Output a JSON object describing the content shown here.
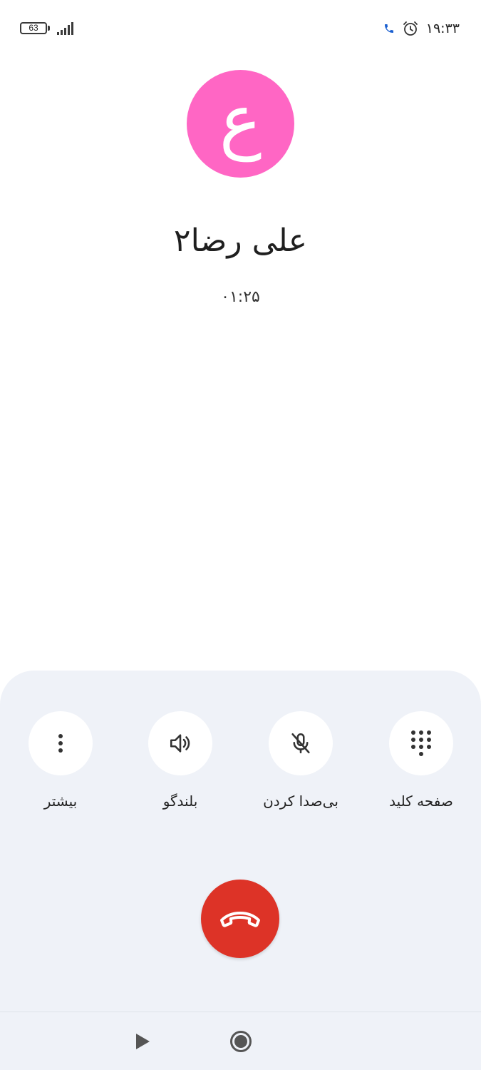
{
  "status_bar": {
    "battery_level": "63",
    "time": "۱۹:۳۳",
    "icons": [
      "battery-icon",
      "signal-icon",
      "call-active-icon",
      "alarm-icon"
    ]
  },
  "contact": {
    "avatar_letter": "ع",
    "avatar_color": "#ff66c4",
    "name": "علی رضا۲",
    "call_duration": "۰۱:۲۵"
  },
  "actions": {
    "keypad_label": "صفحه کلید",
    "mute_label": "بی‌صدا کردن",
    "speaker_label": "بلندگو",
    "more_label": "بیشتر"
  },
  "end_call": {
    "color": "#dd3327",
    "icon": "hangup-icon"
  },
  "nav": {
    "icons": [
      "play-icon",
      "record-icon"
    ]
  }
}
